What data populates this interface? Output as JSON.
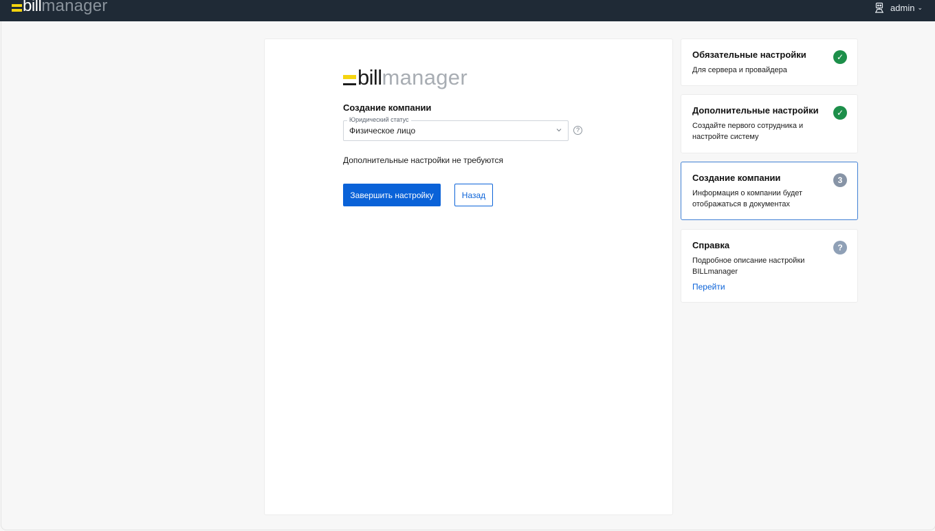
{
  "topbar": {
    "brand_bill": "bill",
    "brand_manager": "manager",
    "user_name": "admin",
    "user_icon": "user-robot-icon",
    "user_chevron_icon": "chevron-down-icon"
  },
  "main": {
    "logo_bill": "bill",
    "logo_manager": "manager",
    "section_title": "Создание компании",
    "legal_status": {
      "label": "Юридический статус",
      "value": "Физическое лицо"
    },
    "help_icon": "?",
    "note": "Дополнительные настройки не требуются",
    "finish_label": "Завершить настройку",
    "back_label": "Назад"
  },
  "steps": [
    {
      "title": "Обязательные настройки",
      "desc": "Для сервера и провайдера",
      "badge": "✓",
      "state": "done"
    },
    {
      "title": "Дополнительные настройки",
      "desc": "Создайте первого сотрудника и настройте систему",
      "badge": "✓",
      "state": "done"
    },
    {
      "title": "Создание компании",
      "desc": "Информация о компании будет отображаться в документах",
      "badge": "3",
      "state": "active"
    },
    {
      "title": "Справка",
      "desc": "Подробное описание настройки BILLmanager",
      "badge": "?",
      "state": "help",
      "link": "Перейти"
    }
  ],
  "colors": {
    "topbar": "#1f2a36",
    "accent": "#0a62d8",
    "brand_yellow": "#f5d40f",
    "done_green": "#1d8f4a"
  }
}
